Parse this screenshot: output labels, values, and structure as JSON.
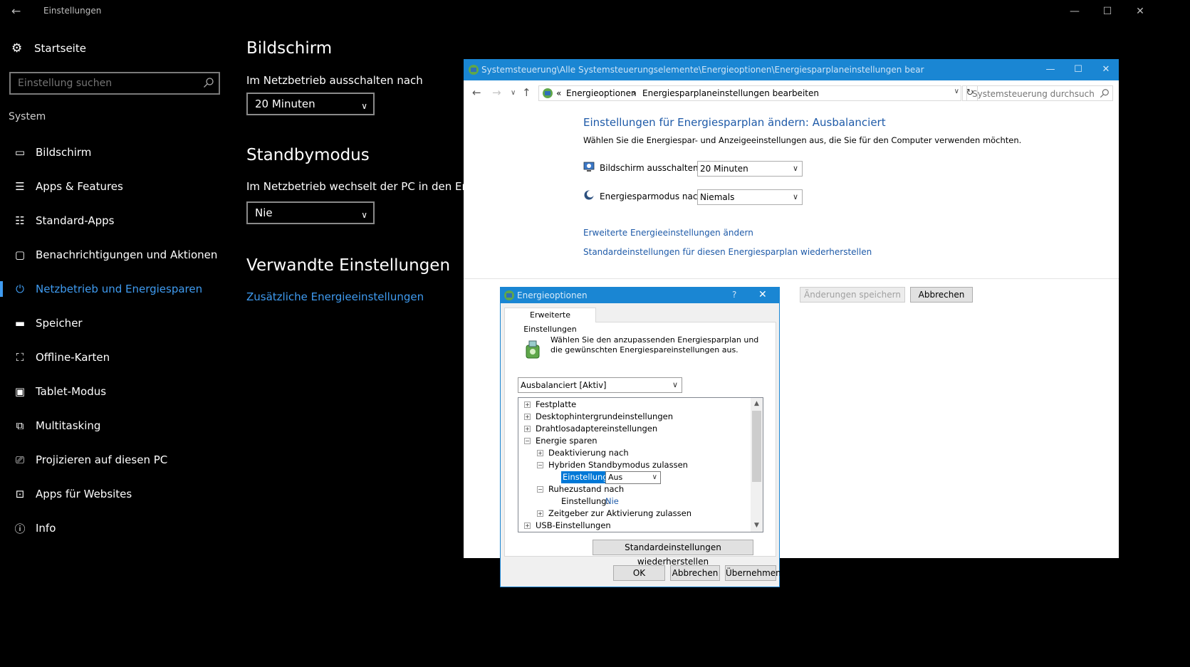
{
  "settings": {
    "window_title": "Einstellungen",
    "home_label": "Startseite",
    "search_placeholder": "Einstellung suchen",
    "section_label": "System",
    "nav_items": [
      {
        "label": "Bildschirm",
        "icon": "monitor-icon"
      },
      {
        "label": "Apps & Features",
        "icon": "list-icon"
      },
      {
        "label": "Standard-Apps",
        "icon": "default-apps-icon"
      },
      {
        "label": "Benachrichtigungen und Aktionen",
        "icon": "notification-icon"
      },
      {
        "label": "Netzbetrieb und Energiesparen",
        "icon": "power-icon",
        "active": true
      },
      {
        "label": "Speicher",
        "icon": "storage-icon"
      },
      {
        "label": "Offline-Karten",
        "icon": "map-icon"
      },
      {
        "label": "Tablet-Modus",
        "icon": "tablet-icon"
      },
      {
        "label": "Multitasking",
        "icon": "multitasking-icon"
      },
      {
        "label": "Projizieren auf diesen PC",
        "icon": "project-icon"
      },
      {
        "label": "Apps für Websites",
        "icon": "web-apps-icon"
      },
      {
        "label": "Info",
        "icon": "info-icon"
      }
    ],
    "main": {
      "screen_heading": "Bildschirm",
      "screen_label": "Im Netzbetrieb ausschalten nach",
      "screen_value": "20 Minuten",
      "standby_heading": "Standbymodus",
      "standby_label": "Im Netzbetrieb wechselt der PC in den Energie",
      "standby_value": "Nie",
      "related_heading": "Verwandte Einstellungen",
      "related_link": "Zusätzliche Energieeinstellungen"
    }
  },
  "control_panel": {
    "title": "Systemsteuerung\\Alle Systemsteuerungselemente\\Energieoptionen\\Energiesparplaneinstellungen bear",
    "breadcrumb_prefix": "«",
    "breadcrumb": [
      "Energieoptionen",
      "Energiesparplaneinstellungen bearbeiten"
    ],
    "breadcrumb_sep": "›",
    "search_placeholder": "Systemsteuerung durchsuchen",
    "heading": "Einstellungen für Energiesparplan ändern: Ausbalanciert",
    "subheading": "Wählen Sie die Energiespar- und Anzeigeeinstellungen aus, die Sie für den Computer verwenden möchten.",
    "display_off_label": "Bildschirm ausschalten:",
    "display_off_value": "20 Minuten",
    "sleep_label": "Energiesparmodus nach:",
    "sleep_value": "Niemals",
    "link_advanced": "Erweiterte Energieeinstellungen ändern",
    "link_restore": "Standardeinstellungen für diesen Energiesparplan wiederherstellen",
    "btn_save": "Änderungen speichern",
    "btn_cancel": "Abbrechen"
  },
  "dialog": {
    "title": "Energieoptionen",
    "help": "?",
    "tab": "Erweiterte Einstellungen",
    "description": "Wählen Sie den anzupassenden Energiesparplan und die gewünschten Energiespareinstellungen aus.",
    "plan": "Ausbalanciert [Aktiv]",
    "tree": {
      "festplatte": "Festplatte",
      "desktop": "Desktophintergrundeinstellungen",
      "wireless": "Drahtlosadaptereinstellungen",
      "energy": "Energie sparen",
      "deactivate": "Deaktivierung nach",
      "hybrid": "Hybriden Standbymodus zulassen",
      "setting_label": "Einstellung:",
      "hybrid_value": "Aus",
      "hibernate": "Ruhezustand nach",
      "hibernate_value": "Nie",
      "timers": "Zeitgeber zur Aktivierung zulassen",
      "usb": "USB-Einstellungen"
    },
    "btn_restore": "Standardeinstellungen wiederherstellen",
    "btn_ok": "OK",
    "btn_cancel": "Abbrechen",
    "btn_apply": "Übernehmen"
  },
  "colors": {
    "accent_dark": "#3f9bf0",
    "titlebar_blue": "#1a86d3",
    "link_blue": "#1e5aa8",
    "selection_blue": "#0078d7"
  }
}
